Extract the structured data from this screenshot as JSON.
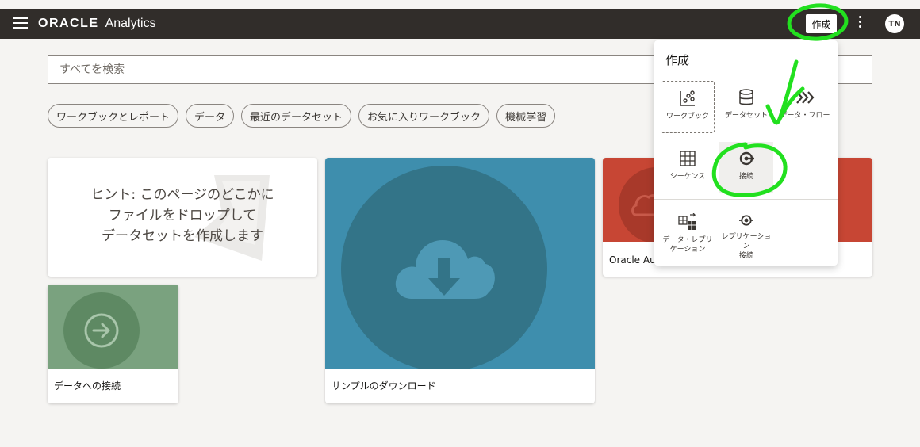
{
  "header": {
    "brand_oracle": "ORACLE",
    "brand_product": "Analytics",
    "create_button": "作成",
    "avatar_initials": "TN"
  },
  "search": {
    "placeholder": "すべてを検索"
  },
  "filter_chips": [
    "ワークブックとレポート",
    "データ",
    "最近のデータセット",
    "お気に入りワークブック",
    "機械学習"
  ],
  "cards": {
    "hint_line1": "ヒント: このページのどこかに",
    "hint_line2": "ファイルをドロップして",
    "hint_line3": "データセットを作成します",
    "connect_label": "データへの接続",
    "sample_label": "サンプルのダウンロード",
    "oracle_label": "Oracle Aut"
  },
  "create_menu": {
    "title": "作成",
    "items": [
      {
        "label": "ワークブック",
        "icon": "workbook-icon"
      },
      {
        "label": "データセット",
        "icon": "dataset-icon"
      },
      {
        "label": "データ・フロー",
        "icon": "dataflow-icon"
      },
      {
        "label": "シーケンス",
        "icon": "sequence-icon"
      },
      {
        "label": "接続",
        "icon": "connection-icon"
      },
      {
        "label1": "データ・レプリ",
        "label2": "ケーション",
        "icon": "data-replication-icon"
      },
      {
        "label1": "レプリケーション",
        "label2": "接続",
        "icon": "replication-connection-icon"
      }
    ]
  },
  "colors": {
    "header_bg": "#312d2a",
    "annotation_green": "#22e01f",
    "connect_card": "#7aa27f",
    "sample_card": "#3e8ead",
    "oracle_card": "#c74634"
  }
}
